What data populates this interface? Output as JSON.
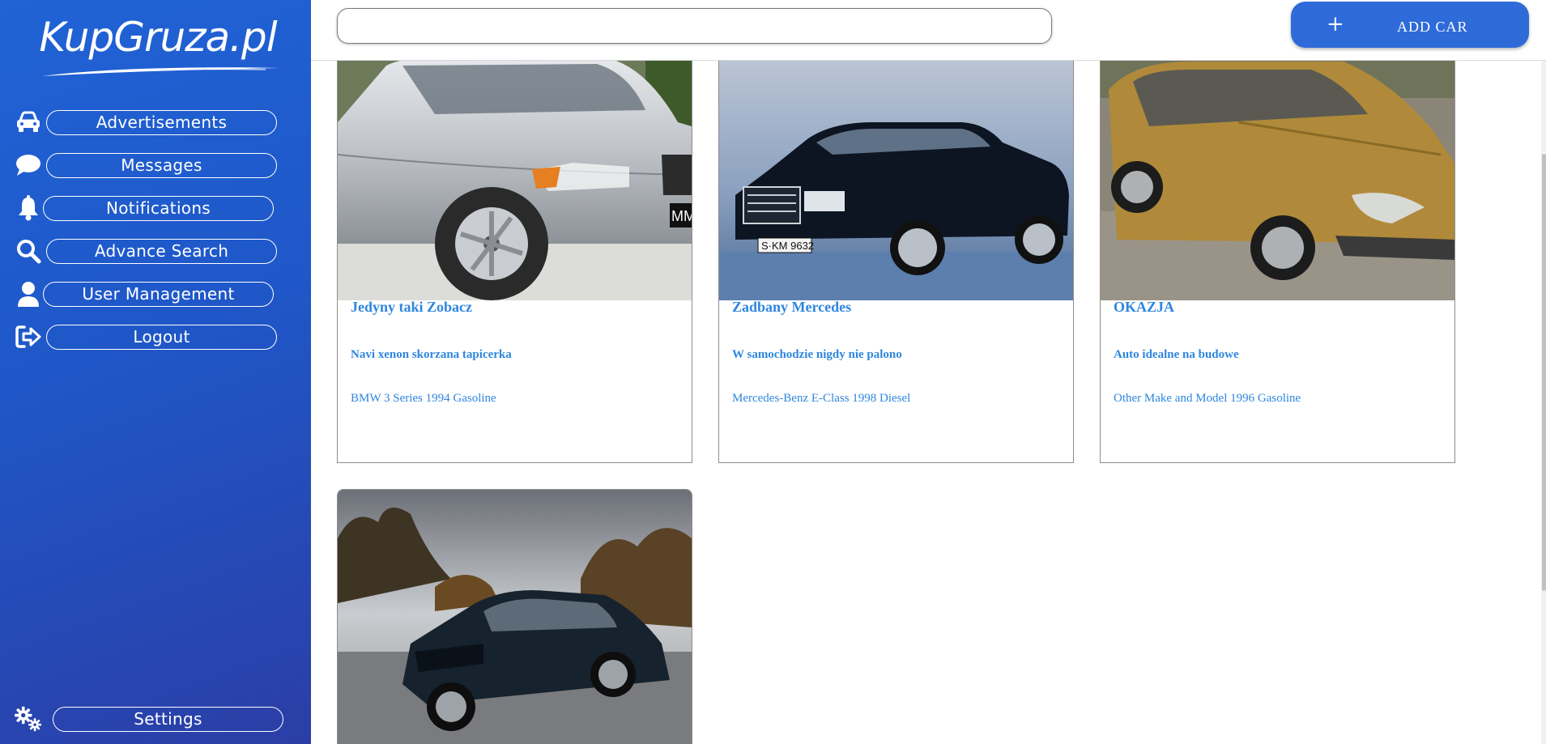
{
  "app": {
    "logo_text": "KupGruza.pl"
  },
  "sidebar": {
    "items": [
      {
        "label": "Advertisements",
        "icon": "car-icon"
      },
      {
        "label": "Messages",
        "icon": "chat-bubble-icon"
      },
      {
        "label": "Notifications",
        "icon": "bell-icon"
      },
      {
        "label": "Advance Search",
        "icon": "search-icon"
      },
      {
        "label": "User Management",
        "icon": "user-icon"
      },
      {
        "label": "Logout",
        "icon": "logout-icon"
      }
    ],
    "settings": {
      "label": "Settings",
      "icon": "gears-icon"
    }
  },
  "topbar": {
    "search": {
      "value": "",
      "placeholder": ""
    },
    "add_car": {
      "plus": "+",
      "label": "ADD CAR"
    }
  },
  "listings": [
    {
      "title": "Jedyny taki Zobacz",
      "description": "Navi xenon skorzana tapicerka",
      "meta": "BMW 3 Series 1994 Gasoline",
      "image": "silver-bmw-photo",
      "plate_text": "MM"
    },
    {
      "title": "Zadbany Mercedes",
      "description": "W samochodzie nigdy nie palono",
      "meta": "Mercedes-Benz E-Class 1998 Diesel",
      "image": "black-mercedes-photo",
      "plate_text": "S·KM 9632"
    },
    {
      "title": "OKAZJA",
      "description": "Auto idealne na budowe",
      "meta": "Other Make and Model 1996 Gasoline",
      "image": "gold-renault-scenic-photo"
    },
    {
      "title": "",
      "description": "",
      "meta": "",
      "image": "dark-bmw-coupe-photo"
    }
  ],
  "colors": {
    "sidebar_start": "#2063d6",
    "sidebar_end": "#2b3ea6",
    "accent": "#2e6bd9",
    "card_text": "#2e86de"
  }
}
